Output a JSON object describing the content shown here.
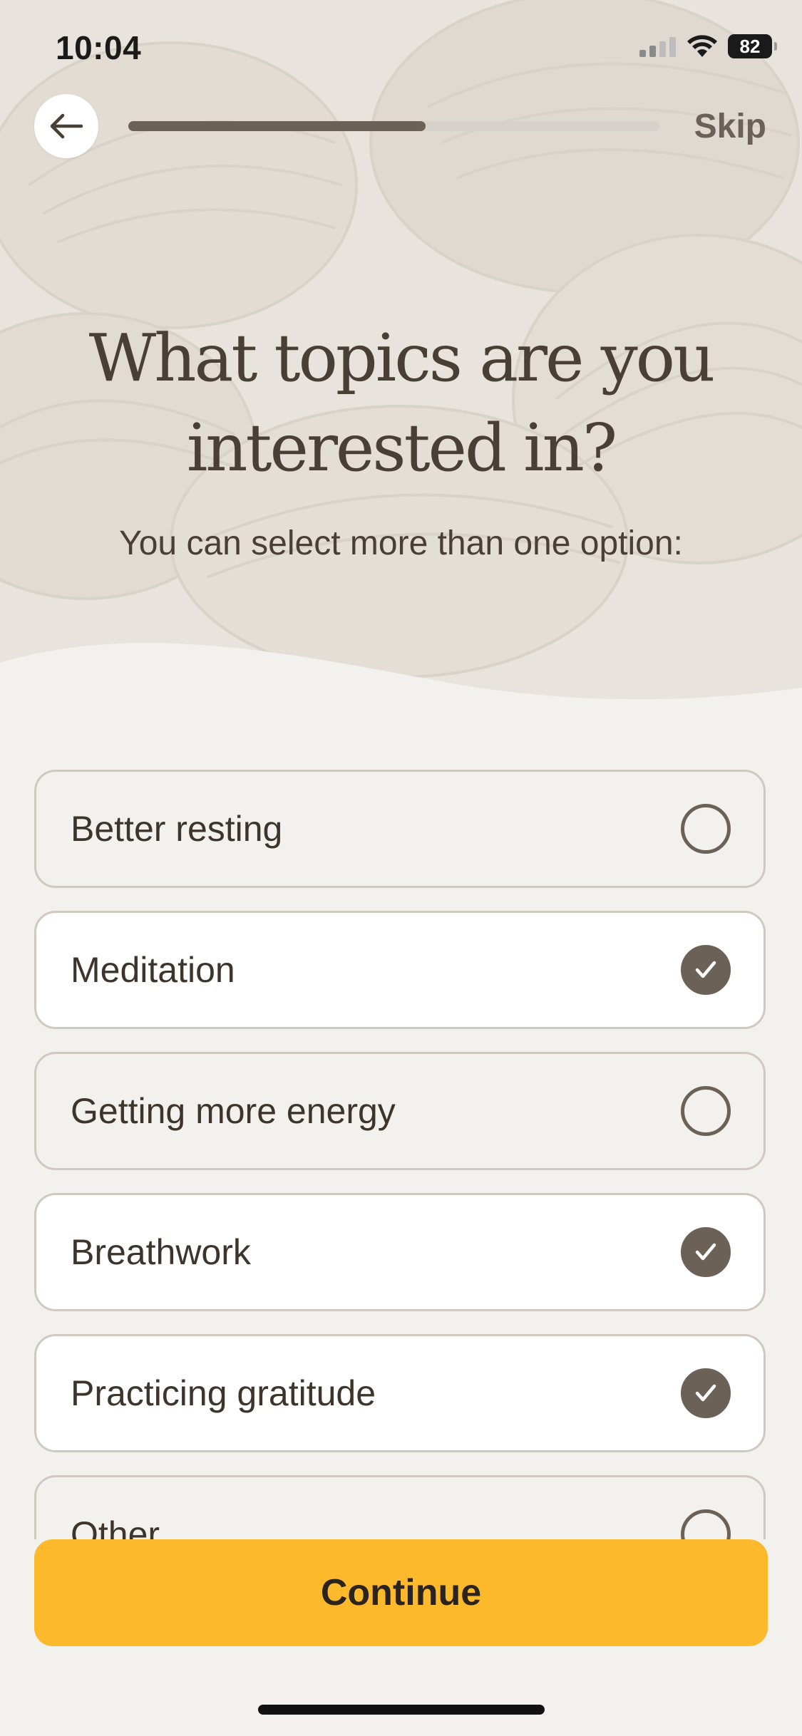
{
  "status_bar": {
    "time": "10:04",
    "battery_level": "82",
    "signal_icon": "cellular-signal-icon",
    "wifi_icon": "wifi-icon",
    "battery_icon": "battery-icon"
  },
  "nav": {
    "back_icon": "arrow-left-icon",
    "skip_label": "Skip",
    "progress_fraction": 0.56
  },
  "header": {
    "title_line1": "What topics are you",
    "title_line2": "interested in?",
    "subtitle": "You can select more than one option:"
  },
  "options": [
    {
      "label": "Better resting",
      "selected": false
    },
    {
      "label": "Meditation",
      "selected": true
    },
    {
      "label": "Getting more energy",
      "selected": false
    },
    {
      "label": "Breathwork",
      "selected": true
    },
    {
      "label": "Practicing gratitude",
      "selected": true
    },
    {
      "label": "Other",
      "selected": false
    }
  ],
  "footer": {
    "continue_label": "Continue"
  },
  "colors": {
    "accent": "#fdb92c",
    "primary_text": "#4a3f35",
    "control": "#6b6157",
    "background": "#f3f1ee"
  }
}
